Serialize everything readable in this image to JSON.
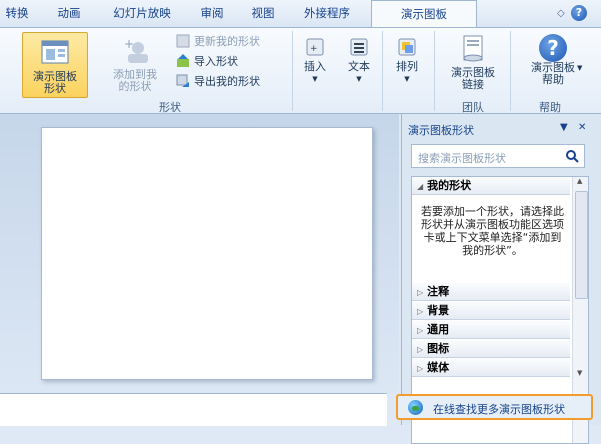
{
  "tabs": [
    "转换",
    "动画",
    "幻灯片放映",
    "审阅",
    "视图",
    "外接程序",
    "演示图板"
  ],
  "ribbon": {
    "storyboard_shapes": "演示图板形状",
    "add_to_my_shapes": "添加到我的形状",
    "update_my_shapes": "更新我的形状",
    "import_shapes": "导入形状",
    "export_my_shapes": "导出我的形状",
    "group_shapes": "形状",
    "insert": "插入",
    "text": "文本",
    "arrange": "排列",
    "storyboard_links": "演示图板链接",
    "group_team": "团队",
    "storyboard_help": "演示图板帮助",
    "group_help": "帮助"
  },
  "pane": {
    "title": "演示图板形状",
    "search_placeholder": "搜索演示图板形状",
    "my_shapes": "我的形状",
    "hint": "若要添加一个形状，请选择此形状并从演示图板功能区选项卡或上下文菜单选择“添加到我的形状”。",
    "sections": [
      "注释",
      "背景",
      "通用",
      "图标",
      "媒体"
    ],
    "online_link": "在线查找更多演示图板形状"
  }
}
